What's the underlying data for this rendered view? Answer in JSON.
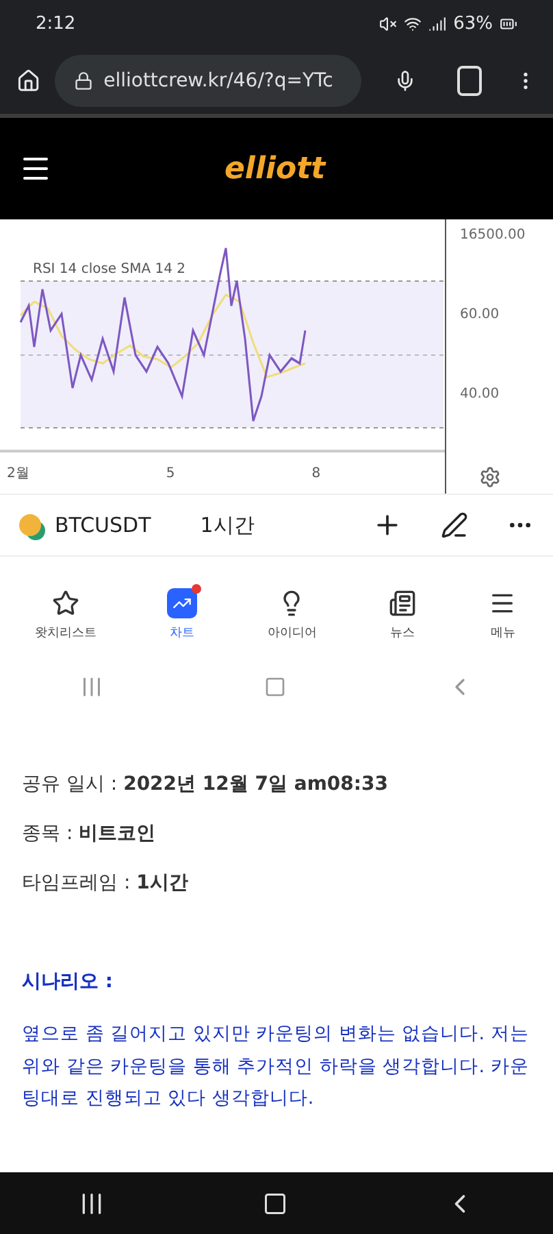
{
  "status_bar": {
    "time": "2:12",
    "battery": "63%"
  },
  "browser": {
    "url": "elliottcrew.kr/46/?q=YTc"
  },
  "site_header": {
    "logo": "elliott"
  },
  "chart": {
    "indicator": "RSI 14 close SMA 14 2",
    "y_labels": [
      "16500.00",
      "60.00",
      "40.00"
    ],
    "x_labels": [
      "2월",
      "5",
      "8"
    ]
  },
  "symbol_row": {
    "symbol": "BTCUSDT",
    "interval": "1시간"
  },
  "app_tabs": [
    {
      "label": "왓치리스트",
      "selected": false,
      "kind": "star"
    },
    {
      "label": "차트",
      "selected": true,
      "kind": "chart"
    },
    {
      "label": "아이디어",
      "selected": false,
      "kind": "bulb"
    },
    {
      "label": "뉴스",
      "selected": false,
      "kind": "news"
    },
    {
      "label": "메뉴",
      "selected": false,
      "kind": "menu"
    }
  ],
  "article": {
    "facts": [
      "공유 일시 : **2022년 12월 7일 am08:33**",
      "종목 : **비트코인**",
      "타임프레임 : **1시간**"
    ],
    "scenario_title": "시나리오 :",
    "scenario_text": "옆으로 좀 길어지고 있지만 카운팅의 변화는 없습니다. 저는 위와 같은 카운팅을 통해 추가적인 하락을 생각합니다. 카운팅대로 진행되고 있다 생각합니다."
  }
}
